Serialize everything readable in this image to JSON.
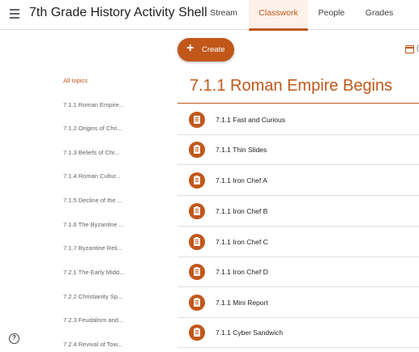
{
  "header": {
    "class_title": "7th Grade History Activity Shell",
    "tabs": [
      {
        "label": "Stream",
        "active": false
      },
      {
        "label": "Classwork",
        "active": true
      },
      {
        "label": "People",
        "active": false
      },
      {
        "label": "Grades",
        "active": false
      }
    ]
  },
  "toolbar": {
    "create_label": "Create",
    "create_icon": "plus-icon",
    "calendar_icon": "calendar-icon"
  },
  "topics": {
    "all_label": "All topics",
    "items": [
      "7.1.1 Roman Empire...",
      "7.1.2 Origins of Chri...",
      "7.1.3 Beliefs of Chr...",
      "7.1.4 Roman Cultur...",
      "7.1.5 Decline of the ...",
      "7.1.6 The Byzantine ...",
      "7.1.7 Byzantine Reli...",
      "7.2.1 The Early Midd...",
      "7.2.2 Christianity Sp...",
      "7.2.3 Feudalism and...",
      "7.2.4 Revival of Tow..."
    ]
  },
  "section": {
    "title": "7.1.1 Roman Empire Begins",
    "items": [
      {
        "name": "7.1.1 Fast and Curious",
        "icon": "material-icon"
      },
      {
        "name": "7.1.1 Thin Slides",
        "icon": "assignment-icon"
      },
      {
        "name": "7.1.1 Iron Chef A",
        "icon": "assignment-icon"
      },
      {
        "name": "7.1.1 Iron Chef B",
        "icon": "assignment-icon"
      },
      {
        "name": "7.1.1 Iron Chef C",
        "icon": "assignment-icon"
      },
      {
        "name": "7.1.1 Iron Chef D",
        "icon": "assignment-icon"
      },
      {
        "name": "7.1.1 Mini Report",
        "icon": "assignment-icon"
      },
      {
        "name": "7.1.1 Cyber Sandwich",
        "icon": "assignment-icon"
      }
    ]
  },
  "footer": {
    "help_icon": "help-icon",
    "help_glyph": "?"
  },
  "colors": {
    "accent": "#c2571a",
    "accent_light": "#fdf1ea",
    "divider": "#e0e0e0"
  }
}
